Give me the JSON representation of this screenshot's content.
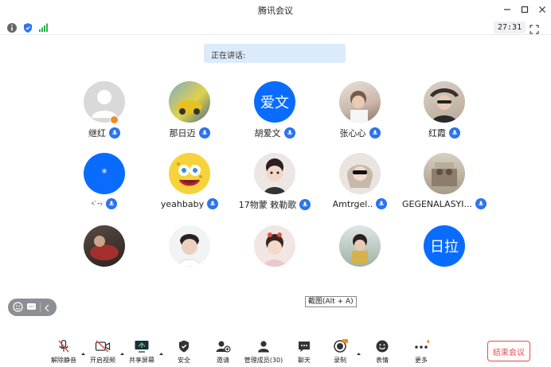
{
  "window": {
    "title": "腾讯会议"
  },
  "header": {
    "timer": "27:31"
  },
  "speaking": {
    "label": "正在讲话:"
  },
  "tooltip": {
    "text": "截图(Alt + A)"
  },
  "participants": [
    {
      "name": "继红",
      "avatar": "default"
    },
    {
      "name": "那日迈",
      "avatar": "photo"
    },
    {
      "name": "胡爱文",
      "avatar": "text",
      "avatar_text": "爱文"
    },
    {
      "name": "张心心",
      "avatar": "photo"
    },
    {
      "name": "红霞",
      "avatar": "photo"
    },
    {
      "name": "ﾍﾞｰｯ",
      "avatar": "text",
      "avatar_text": "*"
    },
    {
      "name": "yeahbaby",
      "avatar": "photo"
    },
    {
      "name": "17物蒙 敕勒歌",
      "avatar": "photo"
    },
    {
      "name": "Amtrgel..",
      "avatar": "photo"
    },
    {
      "name": "GEGENALASYI...",
      "avatar": "photo"
    },
    {
      "name": "",
      "avatar": "photo"
    },
    {
      "name": "",
      "avatar": "photo"
    },
    {
      "name": "",
      "avatar": "photo"
    },
    {
      "name": "",
      "avatar": "photo"
    },
    {
      "name": "",
      "avatar": "text",
      "avatar_text": "日拉"
    }
  ],
  "toolbar": {
    "unmute": "解除静音",
    "video": "开启视频",
    "share": "共享屏幕",
    "security": "安全",
    "invite": "邀请",
    "members": "管理成员(30)",
    "chat": "聊天",
    "record": "录制",
    "reaction": "表情",
    "more": "更多",
    "end": "结束会议"
  },
  "colors": {
    "accent": "#0a6cff",
    "danger": "#e84b4b"
  }
}
